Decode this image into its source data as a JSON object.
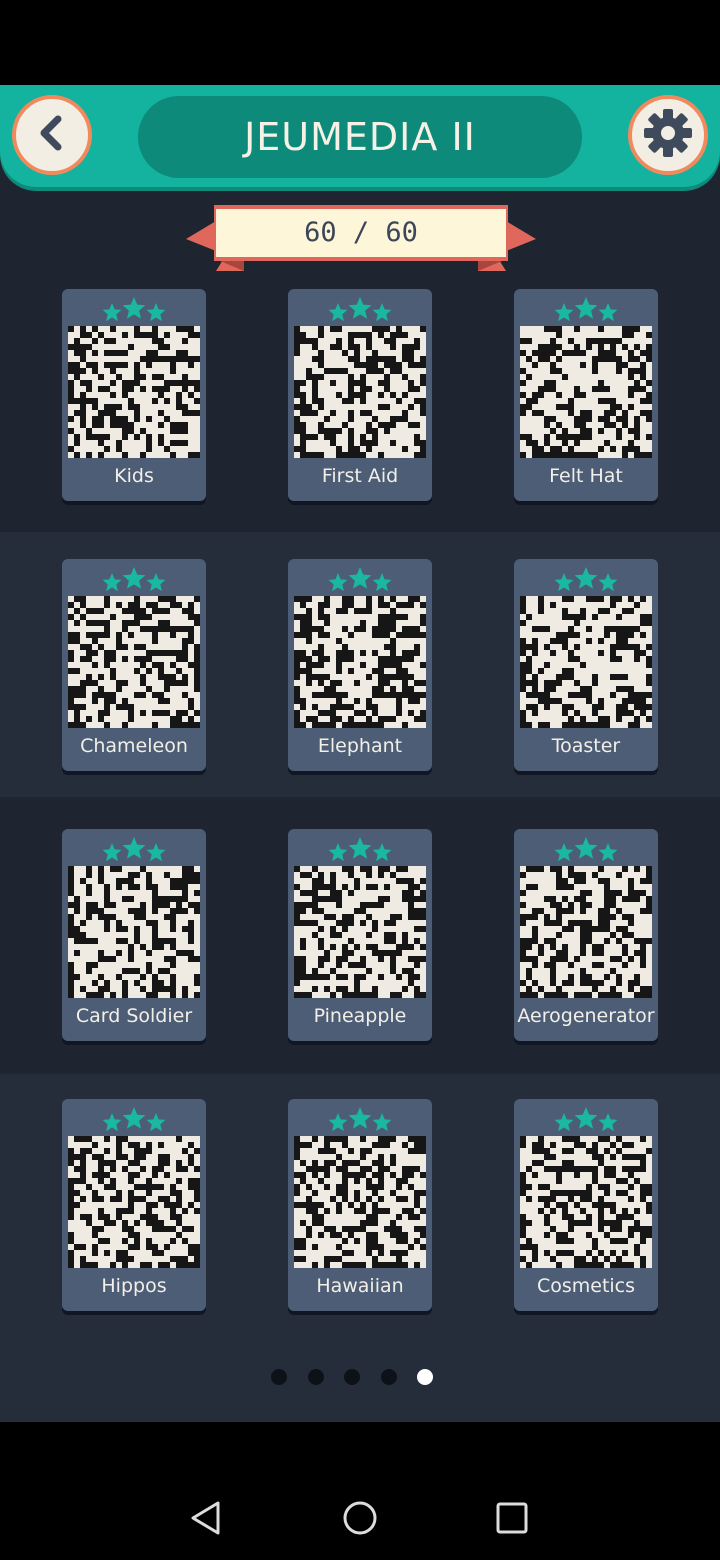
{
  "header": {
    "title": "JEUMEDIA II",
    "back_icon": "chevron-left-icon",
    "settings_icon": "gear-icon"
  },
  "progress": {
    "label": "60 / 60",
    "solved": 60,
    "total": 60
  },
  "puzzles": [
    {
      "name": "Kids",
      "stars": 3
    },
    {
      "name": "First Aid",
      "stars": 3
    },
    {
      "name": "Felt Hat",
      "stars": 3
    },
    {
      "name": "Chameleon",
      "stars": 3
    },
    {
      "name": "Elephant",
      "stars": 3
    },
    {
      "name": "Toaster",
      "stars": 3
    },
    {
      "name": "Card Soldier",
      "stars": 3
    },
    {
      "name": "Pineapple",
      "stars": 3
    },
    {
      "name": "Aerogenerator",
      "stars": 3
    },
    {
      "name": "Hippos",
      "stars": 3
    },
    {
      "name": "Hawaiian",
      "stars": 3
    },
    {
      "name": "Cosmetics",
      "stars": 3
    }
  ],
  "pagination": {
    "pages": 5,
    "current": 5
  },
  "colors": {
    "header": "#14b39f",
    "accent_ring": "#f08a5d",
    "card": "#4c5d75",
    "star": "#19b89f",
    "picture_bg": "#efebe2"
  },
  "system_nav": {
    "icons": [
      "back-triangle-icon",
      "home-circle-icon",
      "recents-square-icon"
    ]
  }
}
